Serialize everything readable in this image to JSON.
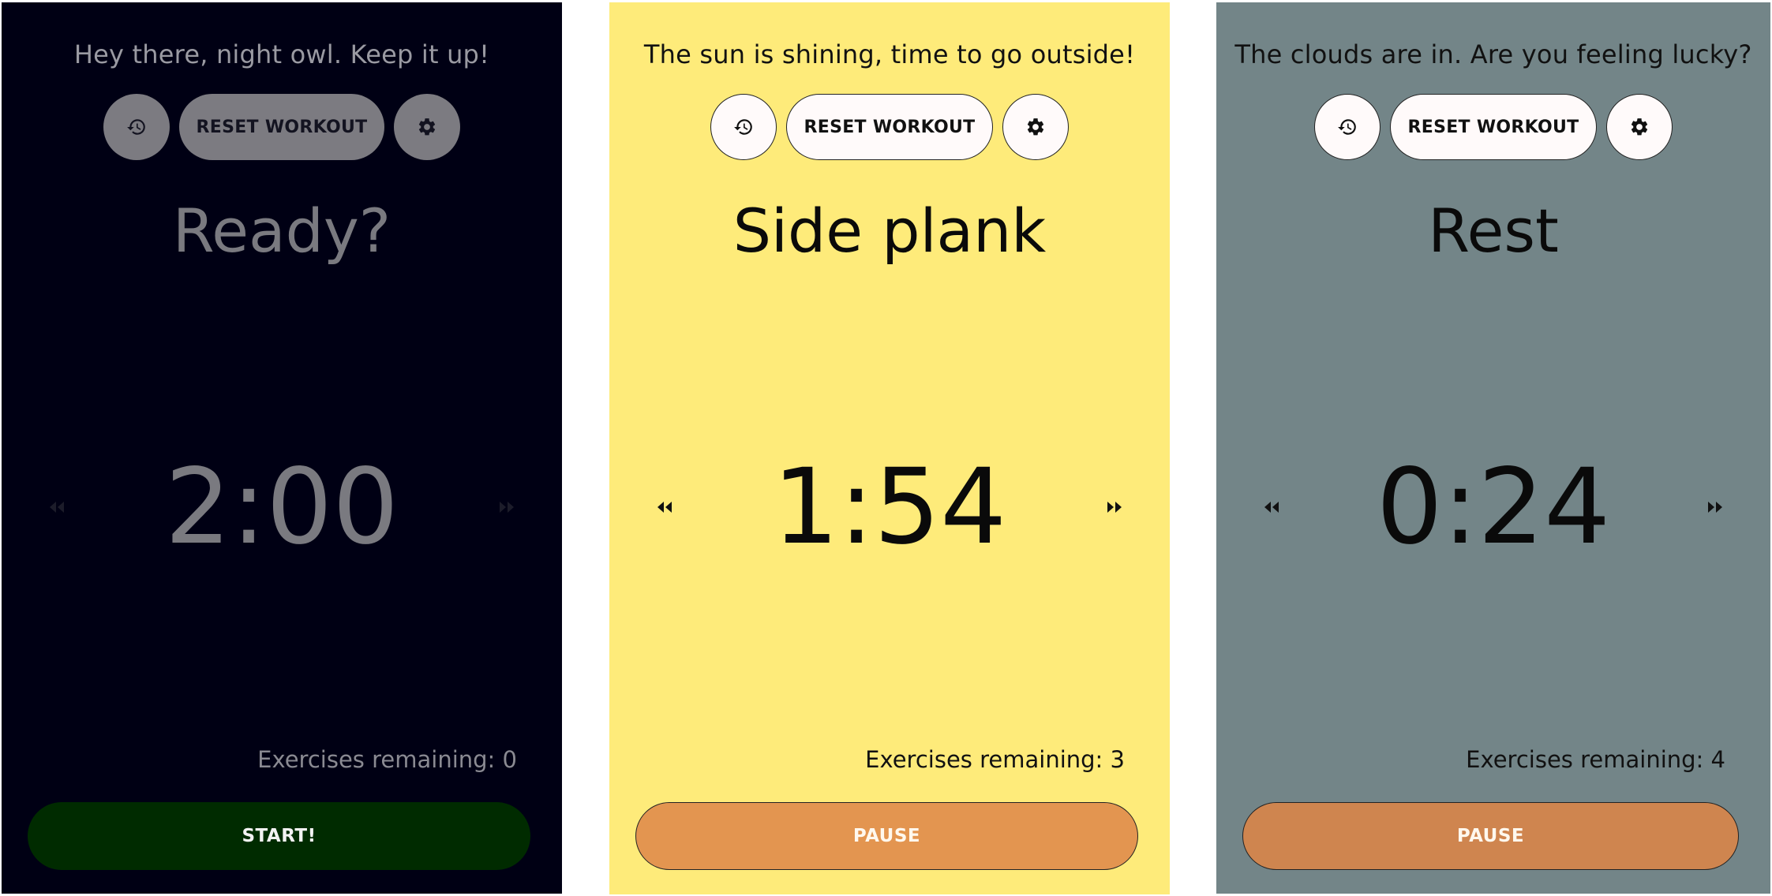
{
  "screens": [
    {
      "theme": "night",
      "background": "#000014",
      "greeting": "Hey there, night owl. Keep it up!",
      "history_icon": "history-icon",
      "reset_label": "RESET WORKOUT",
      "settings_icon": "gear-icon",
      "state_title": "Ready?",
      "timer": "2:00",
      "remaining_label": "Exercises remaining: 0",
      "main_button_label": "START!",
      "main_button_color": "#002b00"
    },
    {
      "theme": "sunny",
      "background": "#feeb7a",
      "greeting": "The sun is shining, time to go outside!",
      "history_icon": "history-icon",
      "reset_label": "RESET WORKOUT",
      "settings_icon": "gear-icon",
      "state_title": "Side plank",
      "timer": "1:54",
      "remaining_label": "Exercises remaining: 3",
      "main_button_label": "PAUSE",
      "main_button_color": "#e39550"
    },
    {
      "theme": "cloudy",
      "background": "#738588",
      "greeting": "The clouds are in. Are you feeling lucky?",
      "history_icon": "history-icon",
      "reset_label": "RESET WORKOUT",
      "settings_icon": "gear-icon",
      "state_title": "Rest",
      "timer": "0:24",
      "remaining_label": "Exercises remaining: 4",
      "main_button_label": "PAUSE",
      "main_button_color": "#cf854f"
    }
  ]
}
